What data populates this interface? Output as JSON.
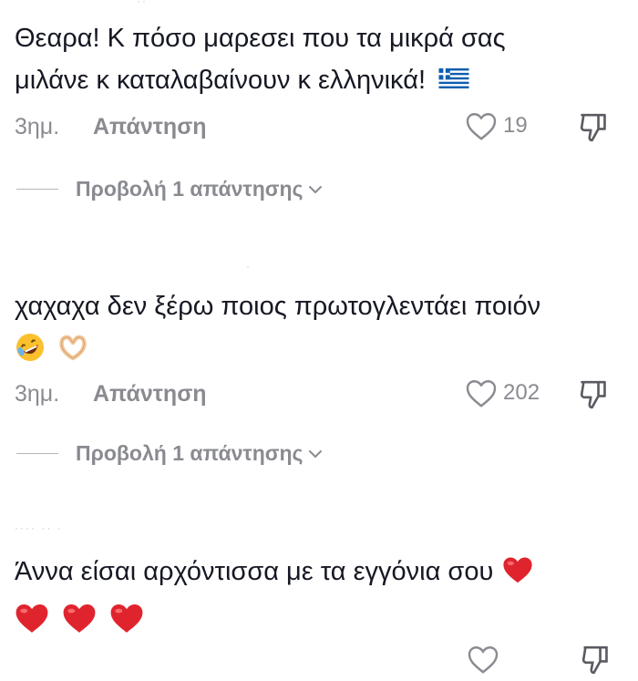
{
  "comments": [
    {
      "lines": [
        "Θεαρα! Κ πόσο μαρεσει που τα μικρά σας",
        "μιλάνε κ καταλαβαίνουν κ ελληνικά!"
      ],
      "emojis": [
        "greece-flag"
      ],
      "time": "3ημ.",
      "reply_label": "Απάντηση",
      "likes": "19",
      "view_replies": "Προβολή 1 απάντησης"
    },
    {
      "lines": [
        "χαχαχα δεν ξέρω ποιος πρωτογλεντάει ποιόν"
      ],
      "emojis": [
        "rolling-laughing-emoji",
        "heart-hands-emoji"
      ],
      "time": "3ημ.",
      "reply_label": "Απάντηση",
      "likes": "202",
      "view_replies": "Προβολή 1 απάντησης"
    },
    {
      "lines": [
        "Άννα είσαι αρχόντισσα με τα εγγόνια σου"
      ],
      "emojis": [
        "red-heart",
        "red-heart",
        "red-heart",
        "red-heart"
      ]
    }
  ],
  "colors": {
    "text": "#161823",
    "meta": "#8a8b91",
    "heart_red": "#e0242e"
  },
  "icons": [
    "heart-outline-icon",
    "dislike-icon",
    "chevron-down-icon"
  ]
}
